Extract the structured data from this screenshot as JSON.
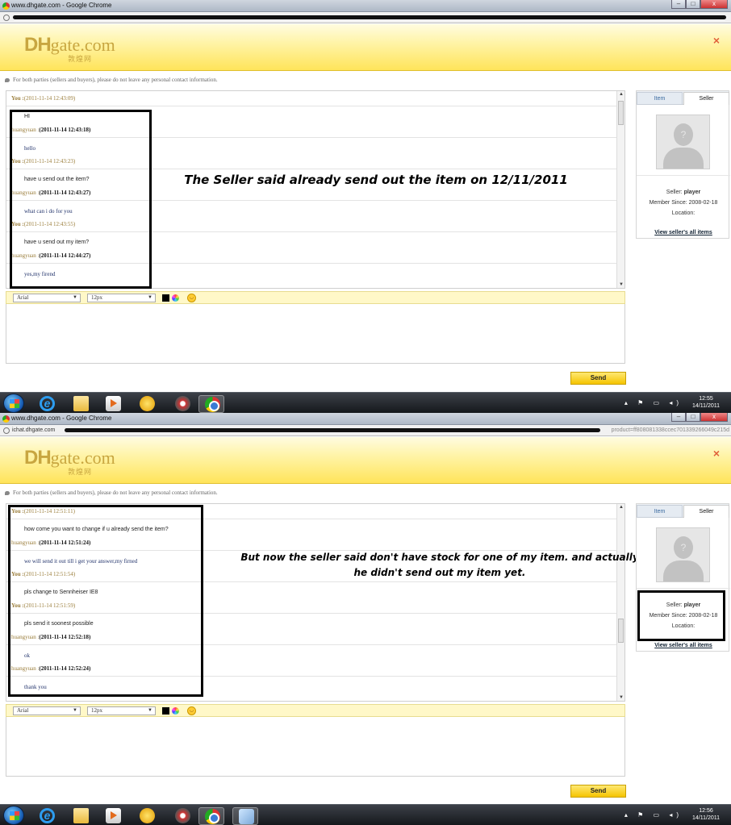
{
  "window1": {
    "title": "www.dhgate.com - Google Chrome",
    "url_prefix": "",
    "url_suffix": "",
    "notice": "For both parties (sellers and buyers), please do not leave any personal contact information.",
    "messages": [
      {
        "who": "You :",
        "time": "(2011-11-14 12:43:09)",
        "kind": "you-header"
      },
      {
        "text": "HI",
        "style": "plain"
      },
      {
        "who": "huangyuan :",
        "time": "(2011-11-14 12:43:18)",
        "kind": "seller-header"
      },
      {
        "text": "hello",
        "style": "blue"
      },
      {
        "who": "You :",
        "time": "(2011-11-14 12:43:23)",
        "kind": "you-header"
      },
      {
        "text": "have u send out the item?",
        "style": "plain"
      },
      {
        "who": "huangyuan :",
        "time": "(2011-11-14 12:43:27)",
        "kind": "seller-header"
      },
      {
        "text": "what can i do for you",
        "style": "blue"
      },
      {
        "who": "You :",
        "time": "(2011-11-14 12:43:55)",
        "kind": "you-header"
      },
      {
        "text": "have u send out my item?",
        "style": "plain"
      },
      {
        "who": "huangyuan :",
        "time": "(2011-11-14 12:44:27)",
        "kind": "seller-header"
      },
      {
        "text": "yes,my firend",
        "style": "blue"
      }
    ],
    "annotation": "The Seller said already send out the item on 12/11/2011",
    "clock_time": "12:55",
    "clock_date": "14/11/2011"
  },
  "window2": {
    "title": "www.dhgate.com - Google Chrome",
    "url_prefix": "ichat.dhgate.com",
    "url_suffix": "product=ff808081338ccec701339266049c215d",
    "notice": "For both parties (sellers and buyers), please do not leave any personal contact information.",
    "messages": [
      {
        "who": "You :",
        "time": "(2011-11-14 12:51:11)",
        "kind": "you-header"
      },
      {
        "text": "how come you want to change if u already send the item?",
        "style": "plain"
      },
      {
        "who": "huangyuan :",
        "time": "(2011-11-14 12:51:24)",
        "kind": "seller-header"
      },
      {
        "text": "we will send it out till i get your answer,my firned",
        "style": "blue"
      },
      {
        "who": "You :",
        "time": "(2011-11-14 12:51:54)",
        "kind": "you-header"
      },
      {
        "text": "pls change to Sennheiser IE8",
        "style": "plain"
      },
      {
        "who": "You :",
        "time": "(2011-11-14 12:51:59)",
        "kind": "you-header"
      },
      {
        "text": "pls send it soonest possible",
        "style": "plain"
      },
      {
        "who": "huangyuan :",
        "time": "(2011-11-14 12:52:18)",
        "kind": "seller-header"
      },
      {
        "text": "ok",
        "style": "blue"
      },
      {
        "who": "huangyuan :",
        "time": "(2011-11-14 12:52:24)",
        "kind": "seller-header"
      },
      {
        "text": "thank you",
        "style": "blue"
      }
    ],
    "annotation_line1": "But now the seller said don't have stock for one of my item. and actually",
    "annotation_line2": "he didn't send out my item yet.",
    "clock_time": "12:56",
    "clock_date": "14/11/2011"
  },
  "shared": {
    "logo_dh": "DH",
    "logo_gate": "gate.com",
    "logo_cn": "敦煌网",
    "close_icon": "×",
    "font_select": "Arial",
    "size_select": "12px",
    "send_label": "Send",
    "tab_item": "Item",
    "tab_seller": "Seller",
    "seller_label": "Seller:",
    "seller_name": "player",
    "member_since": "Member Since: 2008-02-18",
    "location": "Location:",
    "view_all": "View seller's all items",
    "avatar_mark": "?"
  },
  "colors": {
    "header_yellow": "#ffe45a",
    "send_button": "#f5c400",
    "timestamp_gold": "#9a7d3a",
    "seller_msg_blue": "#22336b",
    "close_orange": "#e0603a"
  }
}
